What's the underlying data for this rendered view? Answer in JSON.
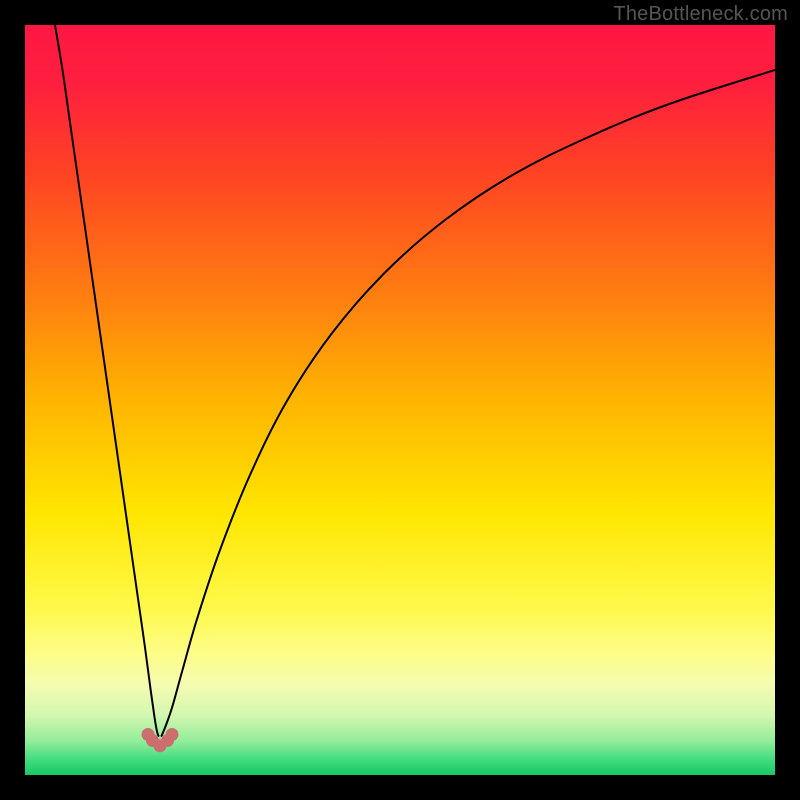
{
  "watermark": {
    "text": "TheBottleneck.com"
  },
  "colors": {
    "frame": "#000000",
    "curve_stroke": "#000000",
    "marker_fill": "#cc6e6e",
    "gradient_stops": [
      {
        "offset": 0.0,
        "color": "#ff1744"
      },
      {
        "offset": 0.08,
        "color": "#ff1f3e"
      },
      {
        "offset": 0.2,
        "color": "#ff4423"
      },
      {
        "offset": 0.35,
        "color": "#ff7a12"
      },
      {
        "offset": 0.5,
        "color": "#ffb400"
      },
      {
        "offset": 0.65,
        "color": "#ffe600"
      },
      {
        "offset": 0.78,
        "color": "#fff94c"
      },
      {
        "offset": 0.84,
        "color": "#fdfd8a"
      },
      {
        "offset": 0.88,
        "color": "#f4fcb0"
      },
      {
        "offset": 0.92,
        "color": "#d3f7b0"
      },
      {
        "offset": 0.955,
        "color": "#93ec9a"
      },
      {
        "offset": 0.98,
        "color": "#3fdc7d"
      },
      {
        "offset": 1.0,
        "color": "#18c864"
      }
    ]
  },
  "chart_data": {
    "type": "line",
    "title": "",
    "xlabel": "",
    "ylabel": "",
    "x_range": [
      0,
      100
    ],
    "y_range": [
      0,
      100
    ],
    "notch_x": 18,
    "series": [
      {
        "name": "left-branch",
        "x": [
          4,
          5,
          6,
          7,
          8,
          9,
          10,
          11,
          12,
          13,
          14,
          15,
          16,
          16.8,
          17.3,
          17.6,
          17.8
        ],
        "values": [
          100,
          94,
          87,
          80,
          73,
          66,
          59,
          52,
          45,
          38,
          31,
          24,
          17,
          11,
          7.5,
          5.8,
          5.2
        ]
      },
      {
        "name": "right-branch",
        "x": [
          18.2,
          18.5,
          19,
          19.7,
          21,
          23,
          26,
          30,
          35,
          41,
          48,
          56,
          65,
          75,
          86,
          100
        ],
        "values": [
          5.2,
          5.9,
          7.2,
          9.3,
          14,
          21,
          30,
          40,
          50,
          59,
          67,
          74,
          80,
          85,
          89.5,
          94
        ]
      }
    ],
    "markers": [
      {
        "x": 16.4,
        "y": 5.4
      },
      {
        "x": 17.0,
        "y": 4.6
      },
      {
        "x": 18.0,
        "y": 3.9
      },
      {
        "x": 19.0,
        "y": 4.6
      },
      {
        "x": 19.6,
        "y": 5.4
      }
    ]
  }
}
